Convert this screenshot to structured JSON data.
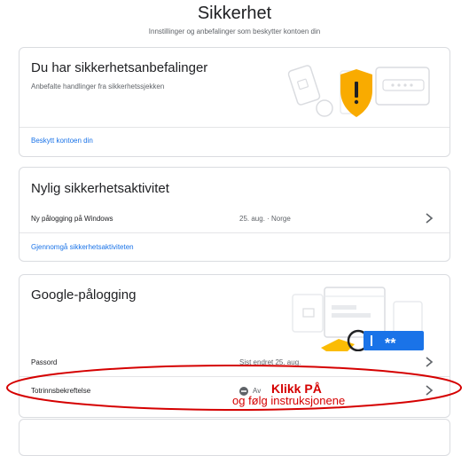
{
  "header": {
    "title": "Sikkerhet",
    "subtitle": "Innstillinger og anbefalinger som beskytter kontoen din"
  },
  "recommendations": {
    "title": "Du har sikkerhetsanbefalinger",
    "description": "Anbefalte handlinger fra sikkerhetssjekken",
    "link": "Beskytt kontoen din"
  },
  "activity": {
    "title": "Nylig sikkerhetsaktivitet",
    "event": {
      "label": "Ny pålogging på Windows",
      "value": "25. aug. · Norge"
    },
    "link": "Gjennomgå sikkerhetsaktiviteten"
  },
  "signin": {
    "title": "Google-pålogging",
    "password": {
      "label": "Passord",
      "value": "Sist endret 25. aug."
    },
    "two_step": {
      "label": "Totrinnsbekreftelse",
      "status": "Av"
    },
    "key_asterisks": "**"
  },
  "annotation": {
    "main": "Klikk PÅ",
    "sub": "og følg instruksjonene"
  },
  "colors": {
    "accent": "#1a73e8",
    "shield": "#f9ab00",
    "key_yellow": "#fbbc04",
    "key_blue": "#1a73e8",
    "annotation": "#d50000"
  }
}
